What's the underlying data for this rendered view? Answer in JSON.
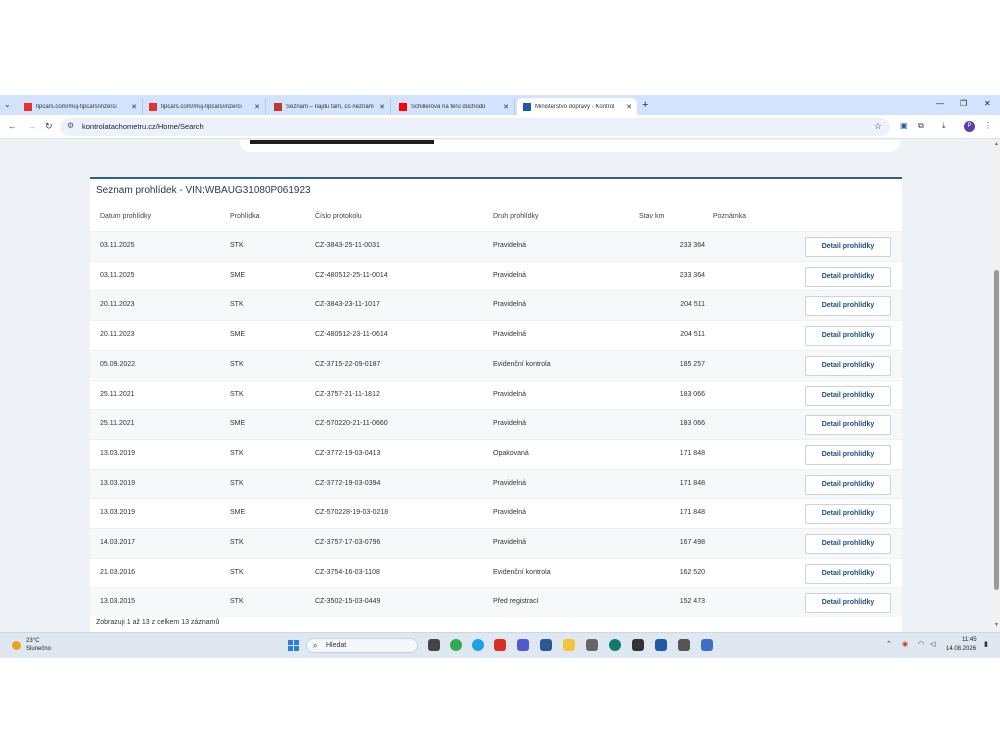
{
  "browser": {
    "tabs": [
      {
        "title": "tipcars.com/muj-tipcars/inzerci",
        "icon": "tipcars-icon",
        "color": "#e2342b"
      },
      {
        "title": "tipcars.com/muj-tipcars/inzerci",
        "icon": "tipcars-icon",
        "color": "#e2342b"
      },
      {
        "title": "Seznam – najdu tam, co neznám",
        "icon": "seznam-icon",
        "color": "#c0392b"
      },
      {
        "title": "Schillerová na feru důchodů",
        "icon": "youtube-icon",
        "color": "#ff0000"
      },
      {
        "title": "Ministerstvo dopravy - Kontrol",
        "icon": "ministry-icon",
        "color": "#1e5aa8"
      }
    ],
    "url": "kontrolatachometru.cz/Home/Search"
  },
  "main": {
    "title": "Seznam prohlídek - VIN:WBAUG31080P061923",
    "columns": [
      "Datum prohlídky",
      "Prohlídka",
      "Číslo protokolu",
      "Druh prohlídky",
      "Stav km",
      "Poznámka"
    ],
    "button_label": "Detail prohlídky",
    "rows": [
      {
        "date": "03.11.2025",
        "type": "STK",
        "protocol": "CZ-3843-25-11-0031",
        "kind": "Pravidelná",
        "km": "233 364",
        "note": ""
      },
      {
        "date": "03.11.2025",
        "type": "SME",
        "protocol": "CZ-480512-25-11-0014",
        "kind": "Pravidelná",
        "km": "233 364",
        "note": ""
      },
      {
        "date": "20.11.2023",
        "type": "STK",
        "protocol": "CZ-3843-23-11-1017",
        "kind": "Pravidelná",
        "km": "204 511",
        "note": ""
      },
      {
        "date": "20.11.2023",
        "type": "SME",
        "protocol": "CZ-480512-23-11-0614",
        "kind": "Pravidelná",
        "km": "204 511",
        "note": ""
      },
      {
        "date": "05.09.2022",
        "type": "STK",
        "protocol": "CZ-3715-22-09-0187",
        "kind": "Evidenční kontrola",
        "km": "185 257",
        "note": ""
      },
      {
        "date": "25.11.2021",
        "type": "STK",
        "protocol": "CZ-3757-21-11-1812",
        "kind": "Pravidelná",
        "km": "183 066",
        "note": ""
      },
      {
        "date": "25.11.2021",
        "type": "SME",
        "protocol": "CZ-570220-21-11-0660",
        "kind": "Pravidelná",
        "km": "183 066",
        "note": ""
      },
      {
        "date": "13.03.2019",
        "type": "STK",
        "protocol": "CZ-3772-19-03-0413",
        "kind": "Opakovaná",
        "km": "171 848",
        "note": ""
      },
      {
        "date": "13.03.2019",
        "type": "STK",
        "protocol": "CZ-3772-19-03-0394",
        "kind": "Pravidelná",
        "km": "171 848",
        "note": ""
      },
      {
        "date": "13.03.2019",
        "type": "SME",
        "protocol": "CZ-570228-19-03-0218",
        "kind": "Pravidelná",
        "km": "171 848",
        "note": ""
      },
      {
        "date": "14.03.2017",
        "type": "STK",
        "protocol": "CZ-3757-17-03-0796",
        "kind": "Pravidelná",
        "km": "167 498",
        "note": ""
      },
      {
        "date": "21.03.2016",
        "type": "STK",
        "protocol": "CZ-3754-16-03-1108",
        "kind": "Evidenční kontrola",
        "km": "162 520",
        "note": ""
      },
      {
        "date": "13.03.2015",
        "type": "STK",
        "protocol": "CZ-3502-15-03-0449",
        "kind": "Před registrací",
        "km": "152 473",
        "note": ""
      }
    ],
    "footer_info": "Zobrazuji 1 až 13 z celkem 13 záznamů"
  },
  "taskbar": {
    "weather_temp": "23°C",
    "weather_cond": "Slunečno",
    "search_placeholder": "Hledat",
    "time": "11:45",
    "date": "14.08.2026"
  }
}
